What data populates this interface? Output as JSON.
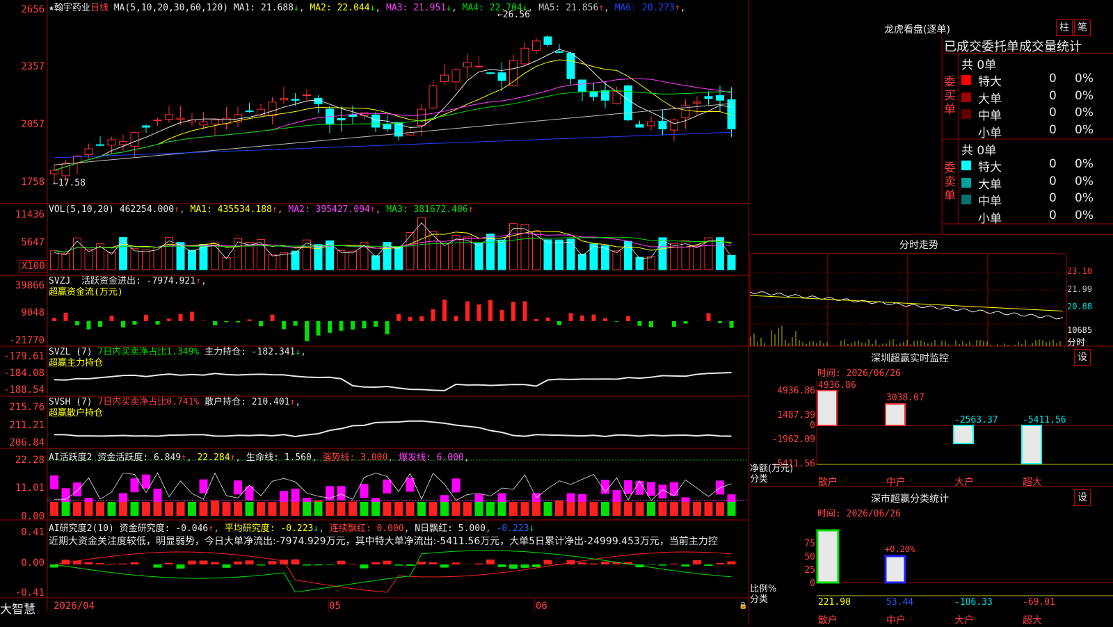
{
  "stock": {
    "star": "★",
    "name": "翰宇药业",
    "period": "日线"
  },
  "ma_header": {
    "label": "MA(5,10,20,30,60,120)",
    "items": [
      {
        "name": "MA1:",
        "value": "21.688",
        "arrow": "↓",
        "color": "#e8e8e8"
      },
      {
        "name": "MA2:",
        "value": "22.044",
        "arrow": "↓",
        "color": "#ffff00"
      },
      {
        "name": "MA3:",
        "value": "21.951",
        "arrow": "↓",
        "color": "#ff40ff"
      },
      {
        "name": "MA4:",
        "value": "22.704",
        "arrow": "↓",
        "color": "#00e000"
      },
      {
        "name": "MA5:",
        "value": "21.856",
        "arrow": "↑",
        "color": "#c0c0c0"
      },
      {
        "name": "MA6:",
        "value": "20.273",
        "arrow": "↑",
        "color": "#2040ff"
      }
    ]
  },
  "price_axis": [
    "2656",
    "2357",
    "2057",
    "1758"
  ],
  "annotations": {
    "high": "26.56",
    "low": "17.58"
  },
  "vol_header": {
    "label": "VOL(5,10,20)",
    "value": "462254.000",
    "arrow": "↑",
    "ma1": "MA1: 435534.188",
    "ma2": "MA2: 395427.094",
    "ma3": "MA3: 381672.406"
  },
  "vol_axis": [
    "11436",
    "5647"
  ],
  "vol_unit": "X100",
  "svzj_header": {
    "label": "SVZJ",
    "text": "活跃资金进出: -7974.921",
    "arrow": "↑",
    "sub": "超赢资金流(万元)"
  },
  "svzj_axis": [
    "39866",
    "9048",
    "-21770"
  ],
  "svzl_header": {
    "label": "SVZL (7)",
    "green": "7日内买卖净占比1.349%",
    "text": "主力持仓: -182.341",
    "arrow": "↓",
    "sub": "超赢主力持仓"
  },
  "svzl_axis": [
    "-179.61",
    "-184.08",
    "-188.54"
  ],
  "svsh_header": {
    "label": "SVSH (7)",
    "red": "7日内买卖净占比0.741%",
    "text": "散户持仓: 210.401",
    "arrow": "↑",
    "sub": "超赢散户持仓"
  },
  "svsh_axis": [
    "215.76",
    "211.21",
    "206.84"
  ],
  "ai1_header": {
    "label": "AI活跃度2",
    "t1": "资金活跃度: 6.849",
    "t2": "22.284",
    "t3": "生命线: 1.560",
    "t4": "强势线: 3.000",
    "t5": "爆发线: 6.000"
  },
  "ai1_axis": [
    "22.28",
    "11.01",
    "0.00"
  ],
  "ai2_header": {
    "label": "AI研究度2(10)",
    "t1": "资金研究度: -0.046",
    "t2": "平均研究度: -0.223",
    "t3": "连续飘红: 0.000",
    "t4": "N日飘红: 5.000",
    "t5": "-0.223"
  },
  "ai2_comment": "近期大资金关注度较低，明显弱势，今日大单净流出:-7974.929万元，其中特大单净流出:-5411.56万元，大单5日累计净出-24999.453万元，当前主力控",
  "ai2_axis": [
    "0.41",
    "0.00",
    "-0.41"
  ],
  "bottom": {
    "logo": "大智慧",
    "d1": "2026/04",
    "d2": "05",
    "d3": "06"
  },
  "lhb": {
    "title": "龙虎看盘(逐单)",
    "btn1": "柱",
    "btn2": "笔",
    "header": "已成交委托单成交量统计",
    "buy_label": "委买单",
    "sell_label": "委卖单",
    "buy_total": "共 0单",
    "sell_total": "共 0单",
    "buy_rows": [
      {
        "label": "特大",
        "count": "0",
        "pct": "0%",
        "color": "#ff0000"
      },
      {
        "label": "大单",
        "count": "0",
        "pct": "0%",
        "color": "#a00000"
      },
      {
        "label": "中单",
        "count": "0",
        "pct": "0%",
        "color": "#600000"
      },
      {
        "label": "小单",
        "count": "0",
        "pct": "0%",
        "color": "#000000"
      }
    ],
    "sell_rows": [
      {
        "label": "特大",
        "count": "0",
        "pct": "0%",
        "color": "#00ffff"
      },
      {
        "label": "大单",
        "count": "0",
        "pct": "0%",
        "color": "#00a0a0"
      },
      {
        "label": "中单",
        "count": "0",
        "pct": "0%",
        "color": "#007070"
      },
      {
        "label": "小单",
        "count": "0",
        "pct": "0%",
        "color": "#000000"
      }
    ]
  },
  "intraday": {
    "title": "分时走势",
    "axis": [
      "23.10",
      "21.99",
      "20.88",
      "10685"
    ],
    "unit": "分时"
  },
  "monitor": {
    "title": "深圳超赢实时监控",
    "btn": "设",
    "time": "时间: 2026/06/26",
    "axis": [
      "4936.86",
      "1487.39",
      "0",
      "-1962.09",
      "-5411.56"
    ],
    "ylabel": "净额(万元)",
    "xlabel": "分类",
    "cats": [
      "散户",
      "中户",
      "大户",
      "超大"
    ],
    "values": [
      "4936.86",
      "3038.07",
      "-2563.37",
      "-5411.56"
    ]
  },
  "classify": {
    "title": "深市超赢分类统计",
    "btn": "设",
    "time": "时间: 2026/06/26",
    "axis": [
      "75",
      "50",
      "25",
      "0"
    ],
    "ylabel": "比例%",
    "xlabel": "分类",
    "cats": [
      "散户",
      "中户",
      "大户",
      "超大"
    ],
    "values": [
      "221.90",
      "53.44",
      "-106.33",
      "-69.01"
    ],
    "note": "+0.20%"
  }
}
